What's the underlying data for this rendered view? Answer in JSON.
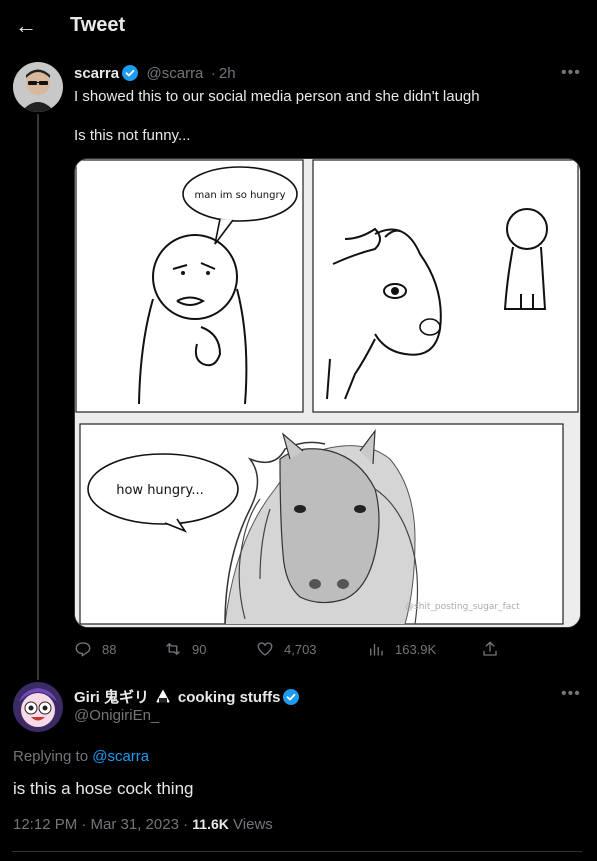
{
  "header": {
    "title": "Tweet"
  },
  "tweet": {
    "name": "scarra",
    "handle": "@scarra",
    "sep": "·",
    "time": "2h",
    "text1": "I showed this to our social media person and she didn't laugh",
    "text2": "Is this not funny...",
    "comic": {
      "bubble1": "man im so hungry",
      "bubble2": "how hungry...",
      "watermark": "@shit_posting_sugar_fact"
    },
    "actions": {
      "replies": "88",
      "retweets": "90",
      "likes": "4,703",
      "views": "163.9K"
    }
  },
  "reply": {
    "name_prefix": "Giri 鬼ギリ",
    "name_suffix": "cooking stuffs",
    "handle": "@OnigiriEn_",
    "replying_prefix": "Replying to",
    "replying_to": "@scarra",
    "text": "is this a hose cock thing",
    "meta_time": "12:12 PM · Mar 31, 2023 ·",
    "meta_views_count": "11.6K",
    "meta_views_label": "Views"
  },
  "colors": {
    "accent": "#1d9bf0",
    "background": "#000000",
    "muted": "#71767b"
  }
}
